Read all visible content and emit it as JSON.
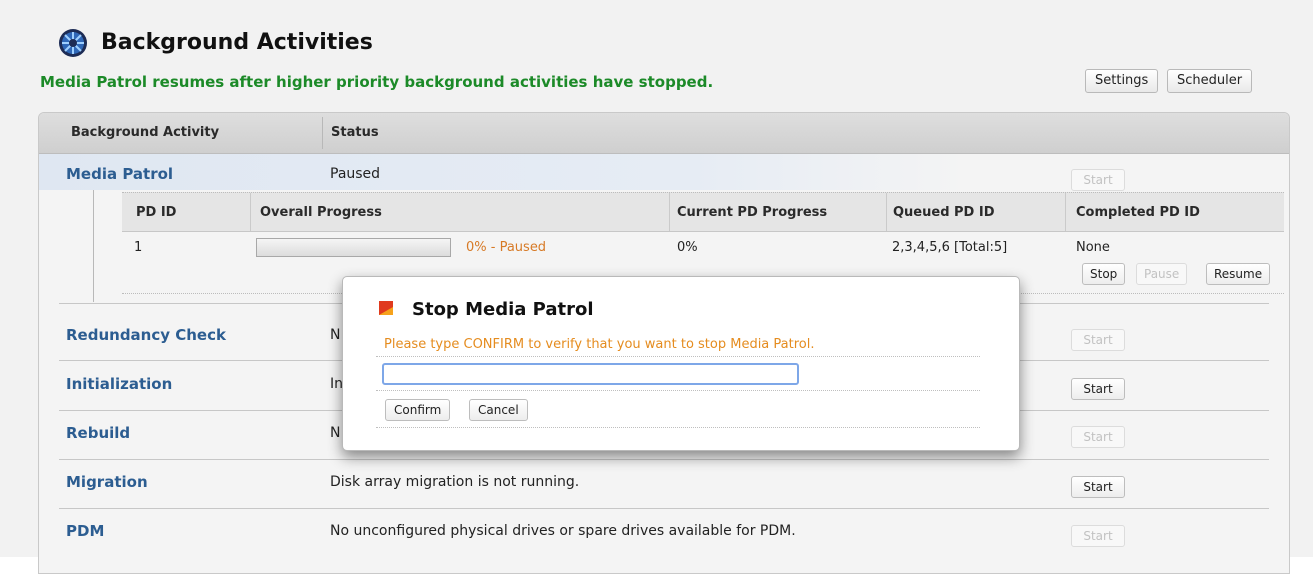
{
  "header": {
    "title": "Background Activities",
    "notice": "Media Patrol resumes after higher priority background activities have stopped.",
    "settings_label": "Settings",
    "scheduler_label": "Scheduler",
    "icon": "globe-icon"
  },
  "table": {
    "columns": [
      "Background Activity",
      "Status"
    ],
    "start_label": "Start"
  },
  "media_patrol": {
    "name": "Media Patrol",
    "status": "Paused",
    "sub_columns": [
      "PD ID",
      "Overall Progress",
      "Current PD Progress",
      "Queued PD ID",
      "Completed PD ID"
    ],
    "row": {
      "pd_id": "1",
      "progress": 0,
      "progress_text": "0% - Paused",
      "current_pd_progress": "0%",
      "queued_pd_id": "2,3,4,5,6 [Total:5]",
      "completed_pd_id": "None"
    },
    "stop_label": "Stop",
    "pause_label": "Pause",
    "resume_label": "Resume"
  },
  "activities": [
    {
      "name": "Redundancy Check",
      "status": "N",
      "start_enabled": false
    },
    {
      "name": "Initialization",
      "status": "In",
      "start_enabled": true
    },
    {
      "name": "Rebuild",
      "status": "N",
      "start_enabled": false
    },
    {
      "name": "Migration",
      "status": "Disk array migration is not running.",
      "start_enabled": true
    },
    {
      "name": "PDM",
      "status": "No unconfigured physical drives or spare drives available for PDM.",
      "start_enabled": false
    }
  ],
  "dialog": {
    "title": "Stop Media Patrol",
    "message": "Please type CONFIRM to verify that you want to stop Media Patrol.",
    "input_value": "",
    "confirm_label": "Confirm",
    "cancel_label": "Cancel",
    "icon": "stop-flag-icon"
  },
  "colors": {
    "notice": "#1c8a28",
    "activity_name": "#2c5d91",
    "warning": "#e58c1f",
    "progress_text": "#d77a26"
  }
}
